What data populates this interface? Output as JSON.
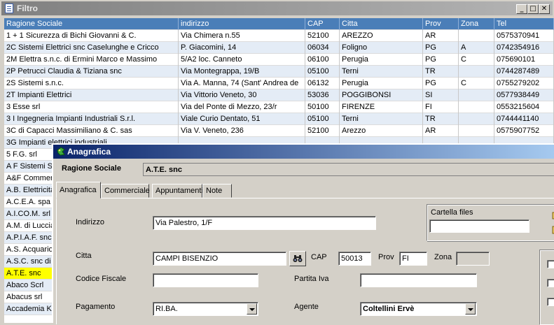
{
  "filtro": {
    "title": "Filtro",
    "controls": {
      "minimize": "_",
      "maximize": "□",
      "close": "✕"
    },
    "columns": [
      "Ragione Sociale",
      "indirizzo",
      "CAP",
      "Citta",
      "Prov",
      "Zona",
      "Tel"
    ],
    "rows": [
      [
        "1 + 1 Sicurezza di Bichi Giovanni & C.",
        "Via Chimera n.55",
        "52100",
        "AREZZO",
        "AR",
        "",
        "0575370941"
      ],
      [
        "2C Sistemi Elettrici snc Caselunghe e Cricco",
        "P. Giacomini, 14",
        "06034",
        "Foligno",
        "PG",
        "A",
        "0742354916"
      ],
      [
        "2M Elettra s.n.c. di Ermini Marco e Massimo",
        "5/A2 loc. Canneto",
        "06100",
        "Perugia",
        "PG",
        "C",
        "075690101"
      ],
      [
        "2P Petrucci Claudia & Tiziana snc",
        "Via Montegrappa, 19/B",
        "05100",
        "Terni",
        "TR",
        "",
        "0744287489"
      ],
      [
        "2S Sistemi s.n.c.",
        "Via A. Manna, 74 (Sant' Andrea de",
        "06132",
        "Perugia",
        "PG",
        "C",
        "0755279202"
      ],
      [
        "2T Impianti Elettrici",
        "Via Vittorio Veneto, 30",
        "53036",
        "POGGIBONSI",
        "SI",
        "",
        "0577938449"
      ],
      [
        "3 Esse srl",
        "Via del Ponte di Mezzo, 23/r",
        "50100",
        "FIRENZE",
        "FI",
        "",
        "0553215604"
      ],
      [
        "3 I Ingegneria Impianti Industriali S.r.l.",
        "Viale Curio Dentato, 51",
        "05100",
        "Terni",
        "TR",
        "",
        "0744441140"
      ],
      [
        "3C di Capacci Massimiliano & C. sas",
        "Via V. Veneto, 236",
        "52100",
        "Arezzo",
        "AR",
        "",
        "0575907752"
      ],
      [
        "3G Impianti elettrici industriali",
        "",
        "",
        "",
        "",
        "",
        ""
      ],
      [
        "5 F.G. srl"
      ],
      [
        "A F Sistemi S."
      ],
      [
        "A&F Commerc"
      ],
      [
        "A.B. Elettricità"
      ],
      [
        "A.C.E.A. spa"
      ],
      [
        "A.I.CO.M. srl"
      ],
      [
        "A.M. di Luccia"
      ],
      [
        "A.P.I.A.F. snc"
      ],
      [
        "A.S. Acquario"
      ],
      [
        "A.S.C. snc di"
      ],
      [
        "A.T.E. snc"
      ],
      [
        "Abaco Scrl"
      ],
      [
        "Abacus srl"
      ],
      [
        "Accademia K"
      ]
    ],
    "selected_index": 20
  },
  "anagrafica": {
    "title": "Anagrafica",
    "ragione_sociale_label": "Ragione Sociale",
    "ragione_sociale_value": "A.T.E. snc",
    "tabs": [
      "Anagrafica",
      "Commerciale",
      "Appuntamenti",
      "Note"
    ],
    "active_tab": 0,
    "indirizzo_label": "Indirizzo",
    "indirizzo_value": "Via Palestro, 1/F",
    "cartella_label": "Cartella files",
    "cartella_value": "",
    "citta_label": "Citta",
    "citta_value": "CAMPI BISENZIO",
    "cap_label": "CAP",
    "cap_value": "50013",
    "prov_label": "Prov",
    "prov_value": "FI",
    "zona_label": "Zona",
    "zona_value": "",
    "codice_fiscale_label": "Codice Fiscale",
    "codice_fiscale_value": "",
    "partita_iva_label": "Partita Iva",
    "partita_iva_value": "",
    "pagamento_label": "Pagamento",
    "pagamento_value": "RI.BA.",
    "agente_label": "Agente",
    "agente_value": "Coltellini Ervè",
    "icons": {
      "search": "binoculars-icon",
      "folder": "folder-icon"
    }
  }
}
